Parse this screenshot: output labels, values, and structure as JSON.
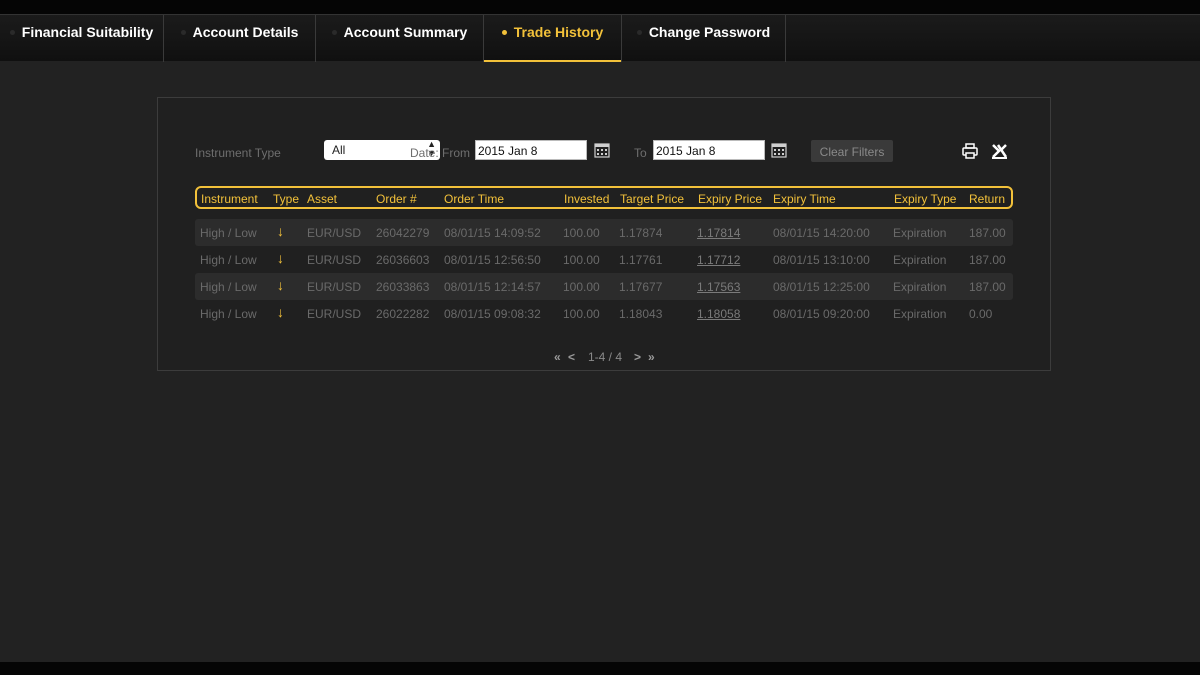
{
  "tabs": [
    {
      "label": "Financial Suitability",
      "active": false
    },
    {
      "label": "Account Details",
      "active": false
    },
    {
      "label": "Account Summary",
      "active": false
    },
    {
      "label": "Trade History",
      "active": true
    },
    {
      "label": "Change Password",
      "active": false
    }
  ],
  "filters": {
    "instrument_type_label": "Instrument Type",
    "instrument_type_value": "All",
    "date_label": "Date:",
    "from_label": "From",
    "from_value": "2015 Jan 8",
    "to_label": "To",
    "to_value": "2015 Jan 8",
    "clear_label": "Clear Filters"
  },
  "table": {
    "headers": [
      "Instrument",
      "Type",
      "Asset",
      "Order #",
      "Order Time",
      "Invested",
      "Target Price",
      "Expiry Price",
      "Expiry Time",
      "Expiry Type",
      "Return"
    ],
    "rows": [
      {
        "instrument": "High / Low",
        "type_icon": "down-arrow",
        "asset": "EUR/USD",
        "order": "26042279",
        "order_time": "08/01/15 14:09:52",
        "invested": "100.00",
        "target": "1.17874",
        "expiry_price": "1.17814",
        "expiry_time": "08/01/15 14:20:00",
        "expiry_type": "Expiration",
        "return": "187.00"
      },
      {
        "instrument": "High / Low",
        "type_icon": "down-arrow",
        "asset": "EUR/USD",
        "order": "26036603",
        "order_time": "08/01/15 12:56:50",
        "invested": "100.00",
        "target": "1.17761",
        "expiry_price": "1.17712",
        "expiry_time": "08/01/15 13:10:00",
        "expiry_type": "Expiration",
        "return": "187.00"
      },
      {
        "instrument": "High / Low",
        "type_icon": "down-arrow",
        "asset": "EUR/USD",
        "order": "26033863",
        "order_time": "08/01/15 12:14:57",
        "invested": "100.00",
        "target": "1.17677",
        "expiry_price": "1.17563",
        "expiry_time": "08/01/15 12:25:00",
        "expiry_type": "Expiration",
        "return": "187.00"
      },
      {
        "instrument": "High / Low",
        "type_icon": "down-arrow",
        "asset": "EUR/USD",
        "order": "26022282",
        "order_time": "08/01/15 09:08:32",
        "invested": "100.00",
        "target": "1.18043",
        "expiry_price": "1.18058",
        "expiry_time": "08/01/15 09:20:00",
        "expiry_type": "Expiration",
        "return": "0.00"
      }
    ]
  },
  "pager": {
    "first": "«",
    "prev": "<",
    "status": "1-4 / 4",
    "next": ">",
    "last": "»"
  },
  "colors": {
    "accent": "#f2c13a",
    "background": "#222222"
  }
}
